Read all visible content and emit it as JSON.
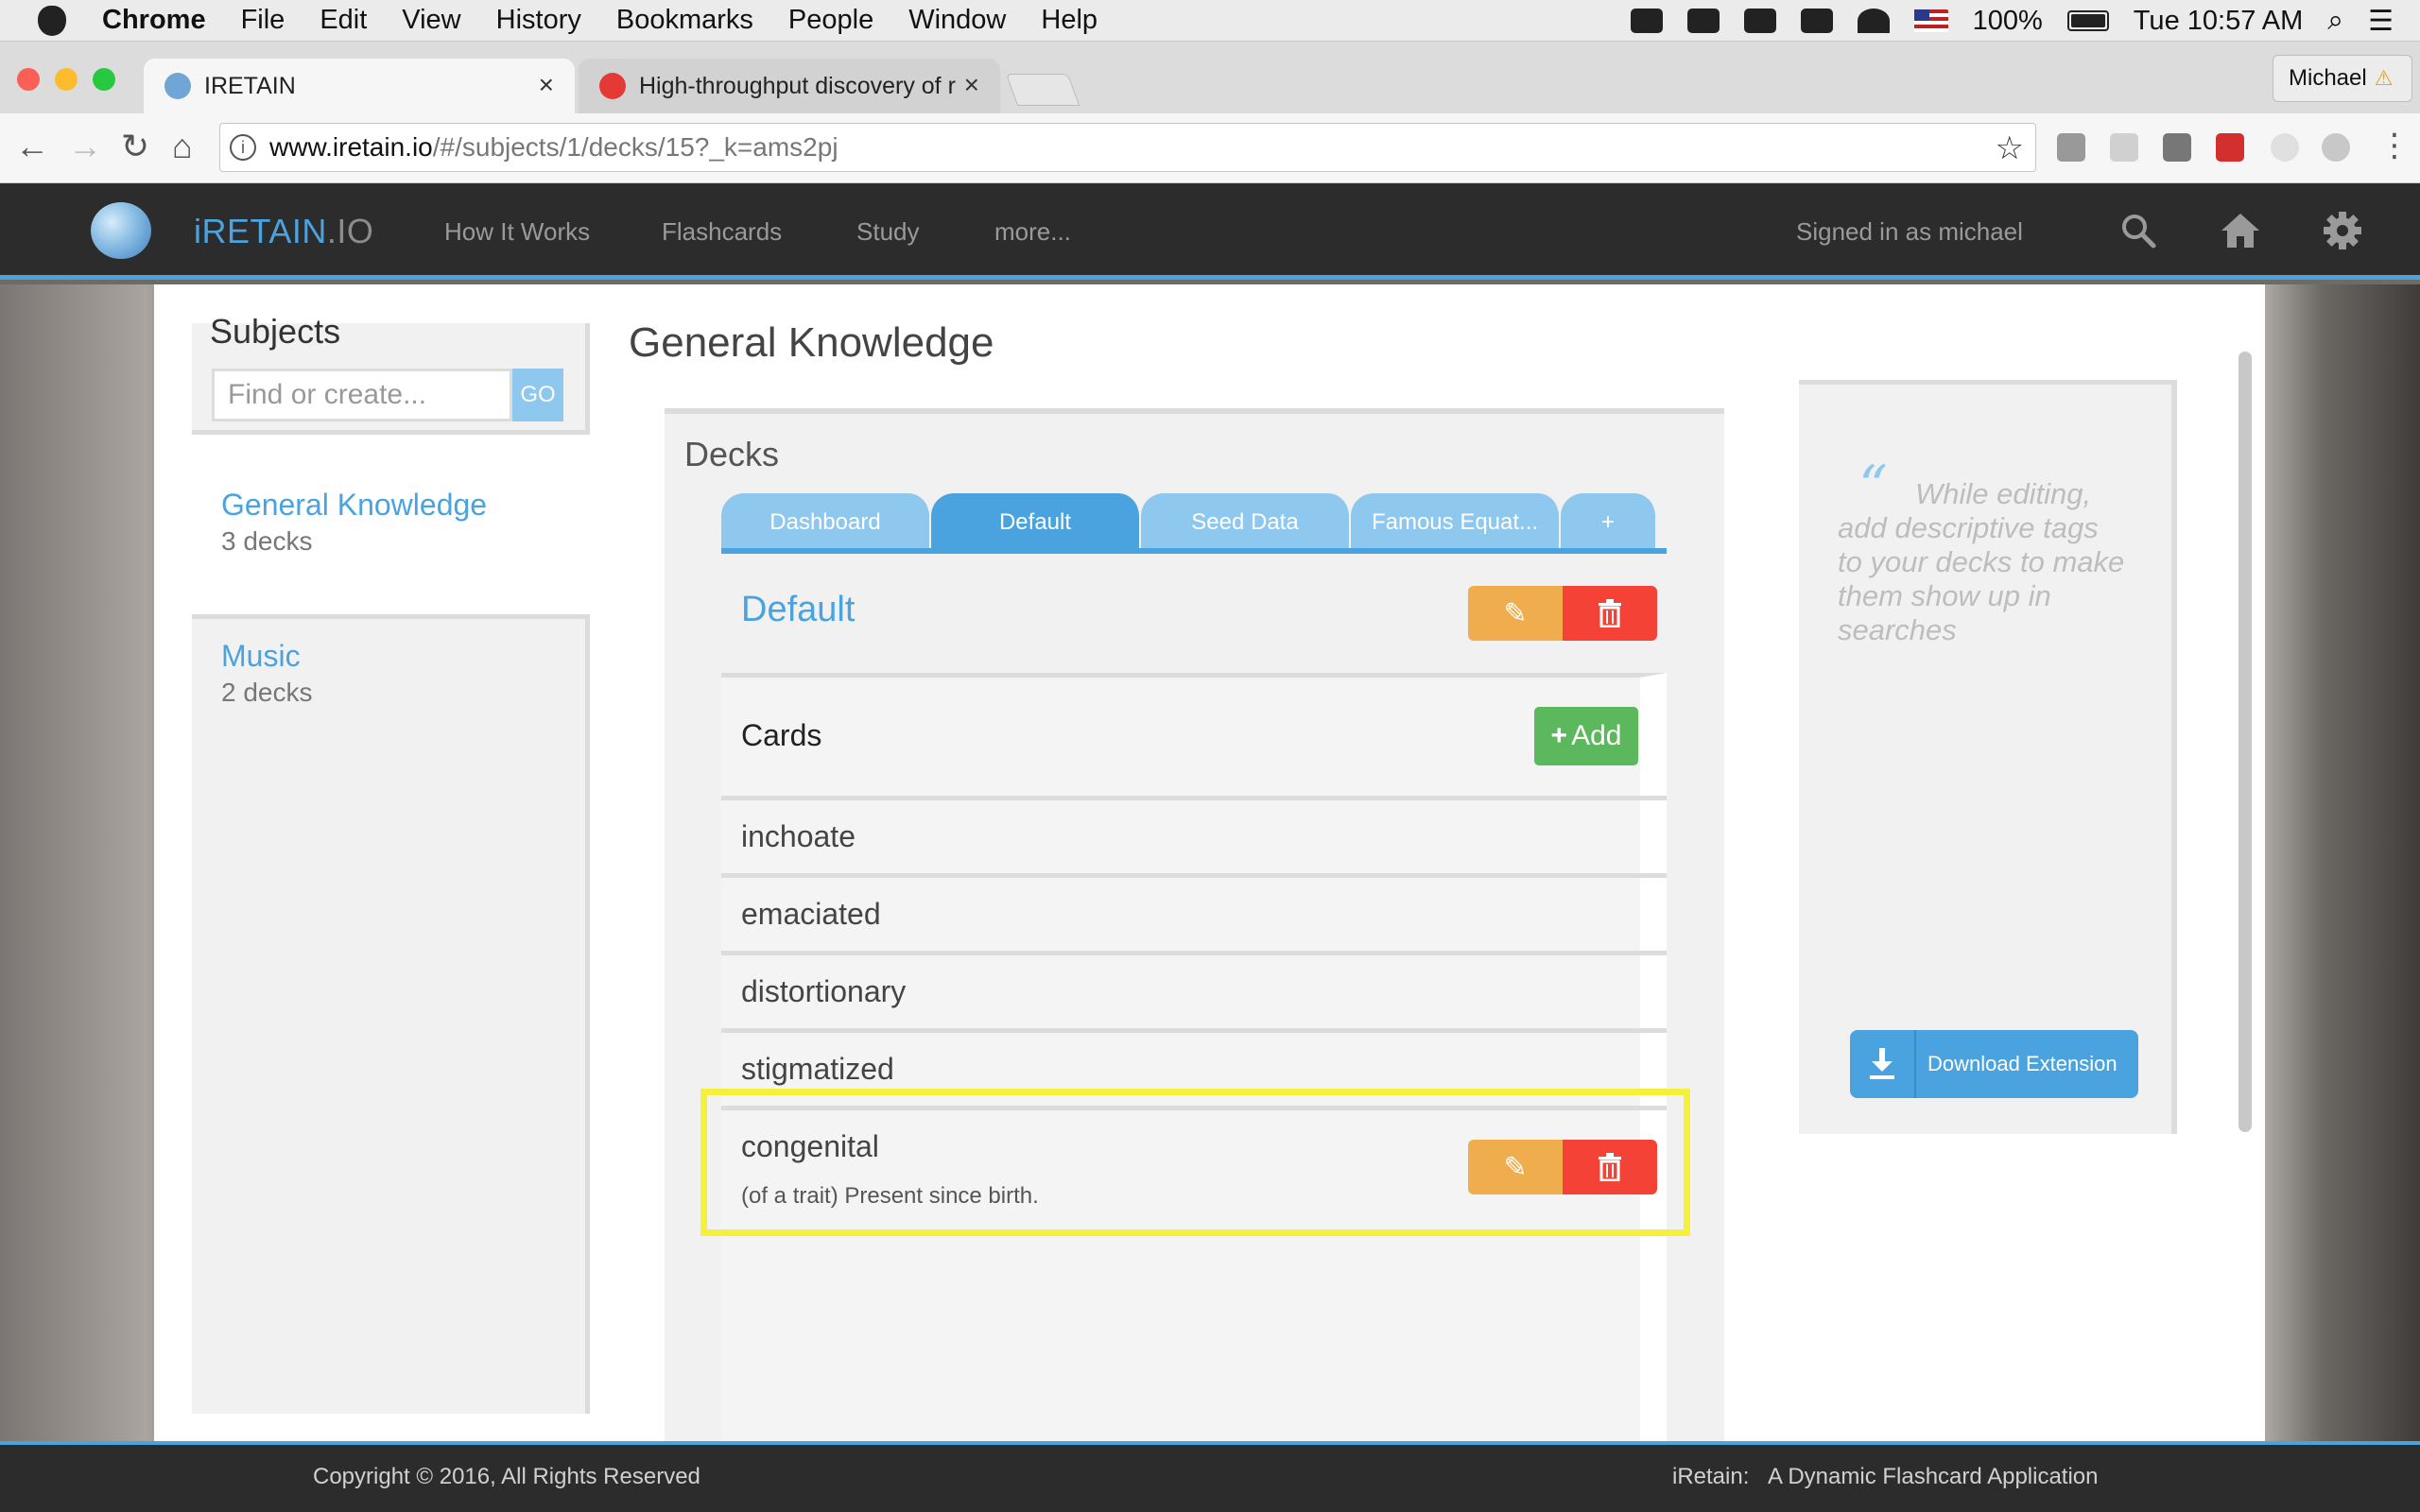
{
  "menubar": {
    "app": "Chrome",
    "items": [
      "File",
      "Edit",
      "View",
      "History",
      "Bookmarks",
      "People",
      "Window",
      "Help"
    ],
    "battery": "100%",
    "clock": "Tue 10:57 AM"
  },
  "browser": {
    "tabs": [
      {
        "title": "IRETAIN"
      },
      {
        "title": "High-throughput discovery of r"
      }
    ],
    "profile": "Michael",
    "url_host": "www.iretain.io",
    "url_path": "/#/subjects/1/decks/15?_k=ams2pj"
  },
  "site": {
    "brand_main": "iRETAIN",
    "brand_suffix": ".IO",
    "nav": [
      "How It Works",
      "Flashcards",
      "Study",
      "more..."
    ],
    "signed_in": "Signed in as michael"
  },
  "sidebar": {
    "title": "Subjects",
    "search_placeholder": "Find or create...",
    "go_label": "GO",
    "subjects": [
      {
        "name": "General Knowledge",
        "count": "3 decks"
      },
      {
        "name": "Music",
        "count": "2 decks"
      }
    ]
  },
  "main": {
    "title": "General Knowledge",
    "decks_title": "Decks",
    "deck_tabs": [
      "Dashboard",
      "Default",
      "Seed Data",
      "Famous Equat...",
      "+"
    ],
    "active_deck": "Default",
    "cards_title": "Cards",
    "add_label": "Add",
    "cards": [
      "inchoate",
      "emaciated",
      "distortionary",
      "stigmatized",
      "congenital"
    ],
    "expanded_card": {
      "term": "congenital",
      "definition": "(of a trait) Present since birth."
    }
  },
  "tip": {
    "quote_mark": "“",
    "text": "While editing, add descriptive tags to your decks to make them show up in searches",
    "download_label": "Download Extension"
  },
  "footer": {
    "copyright": "Copyright © 2016, All Rights Reserved",
    "app_name": "iRetain:",
    "tagline": "A Dynamic Flashcard Application"
  },
  "colors": {
    "accent": "#4aa3df",
    "edit": "#f0ad4e",
    "delete": "#f44336",
    "add": "#5cb85c",
    "highlight": "#f5f03c"
  }
}
